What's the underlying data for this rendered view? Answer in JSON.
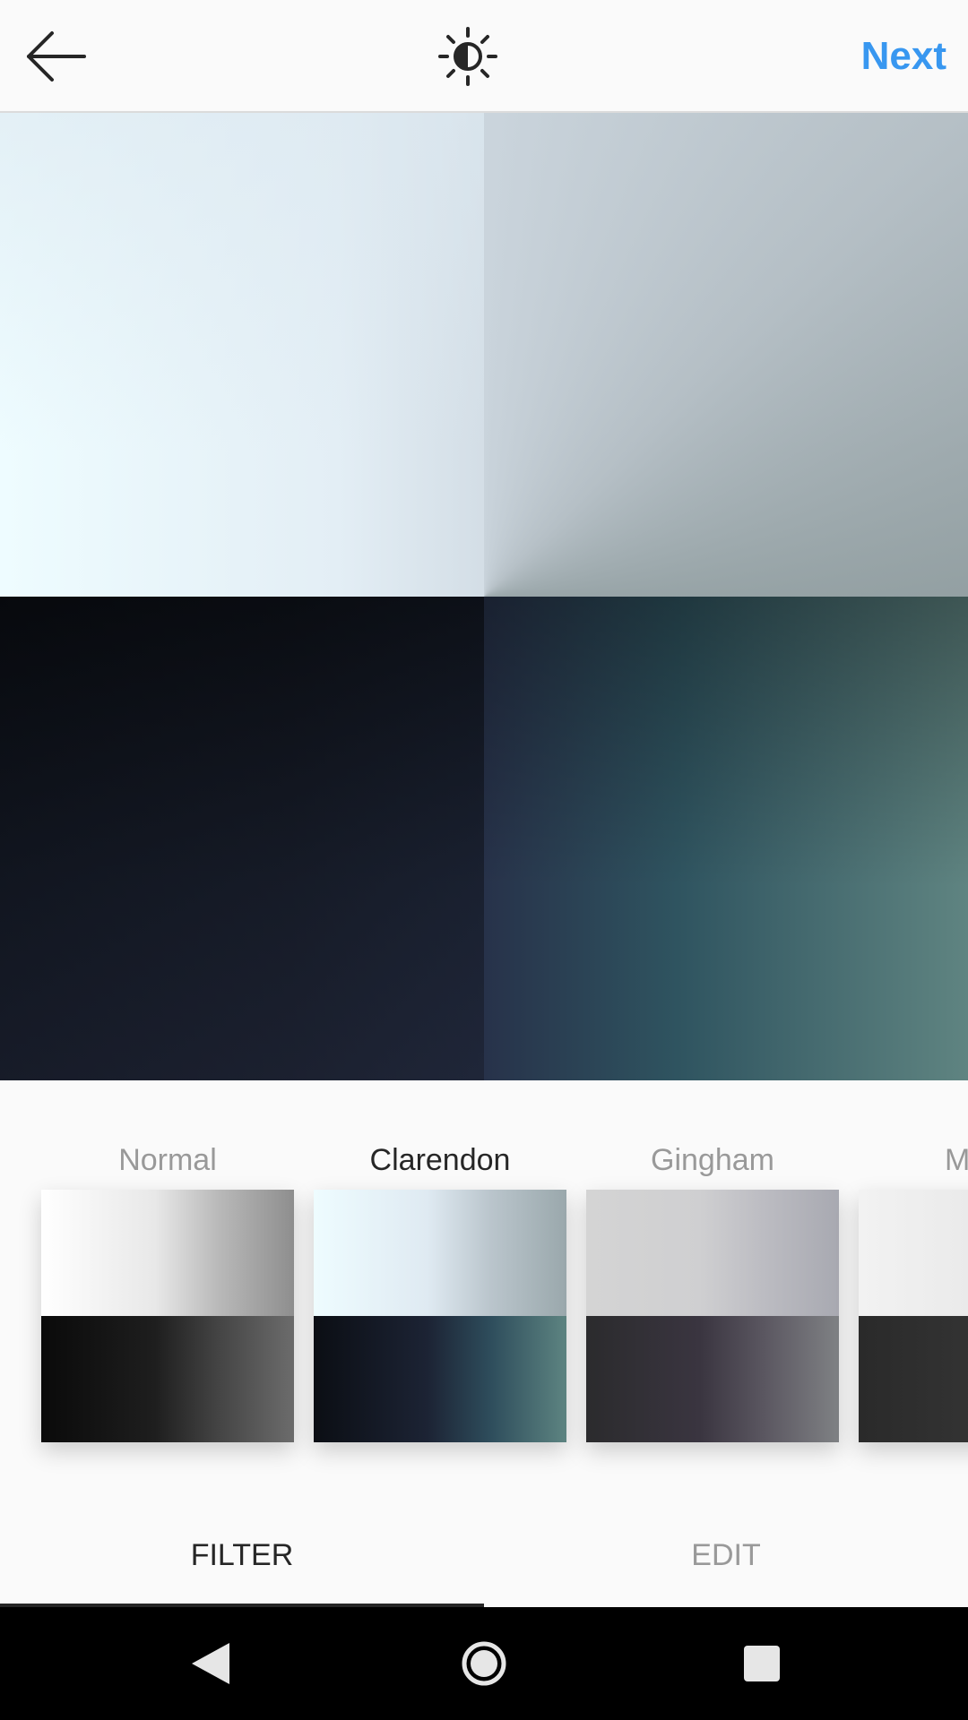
{
  "header": {
    "back_icon": "arrow-left-icon",
    "lux_icon": "brightness-contrast-icon",
    "next_label": "Next",
    "accent_color": "#3897f0"
  },
  "filters": [
    {
      "label": "Normal",
      "active": false
    },
    {
      "label": "Clarendon",
      "active": true
    },
    {
      "label": "Gingham",
      "active": false
    },
    {
      "label": "M",
      "active": false
    }
  ],
  "tabs": {
    "filter_label": "FILTER",
    "edit_label": "EDIT",
    "active": "FILTER"
  },
  "system_nav": {
    "back_icon": "nav-back-icon",
    "home_icon": "nav-home-icon",
    "recents_icon": "nav-recents-icon"
  }
}
